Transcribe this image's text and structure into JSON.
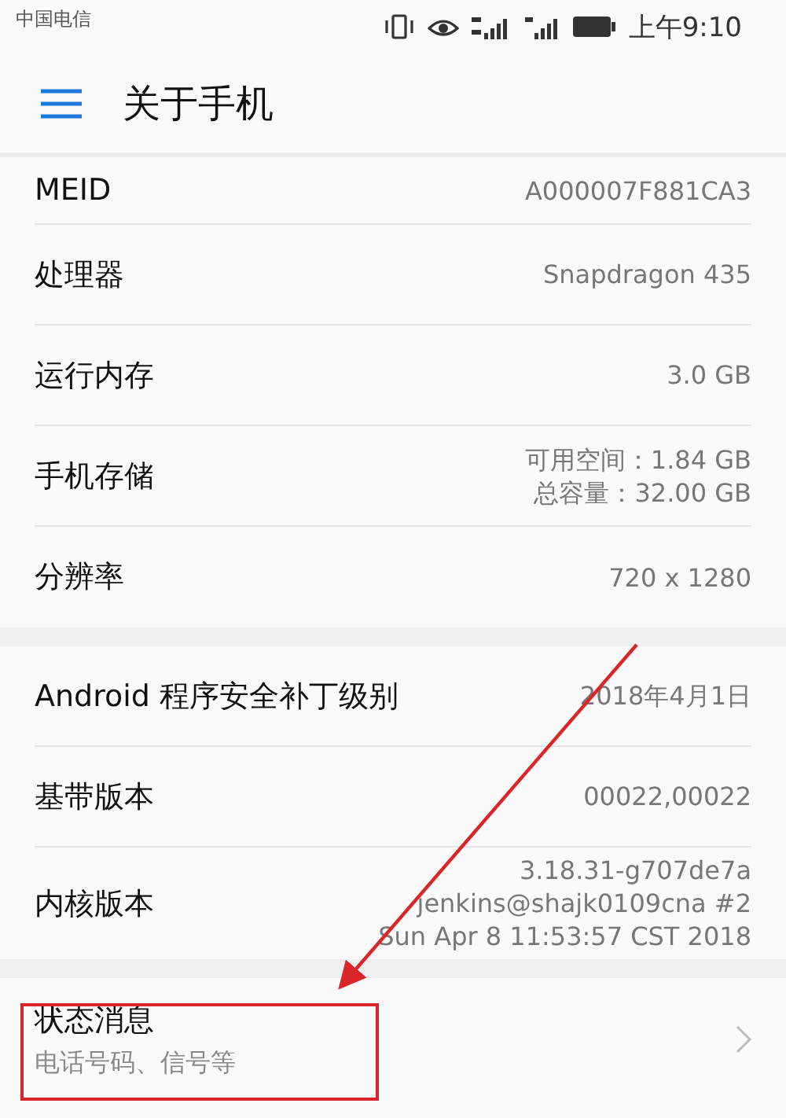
{
  "status_bar": {
    "carrier": "中国电信",
    "time": "上午9:10"
  },
  "app_bar": {
    "title": "关于手机"
  },
  "sections": [
    {
      "rows": [
        {
          "kind": "value",
          "label": "MEID",
          "values": [
            "A000007F881CA3"
          ]
        },
        {
          "kind": "value",
          "label": "处理器",
          "values": [
            "Snapdragon 435"
          ]
        },
        {
          "kind": "value",
          "label": "运行内存",
          "values": [
            "3.0 GB"
          ]
        },
        {
          "kind": "value",
          "label": "手机存储",
          "values": [
            "可用空间：1.84  GB",
            "总容量：32.00  GB"
          ]
        },
        {
          "kind": "value",
          "label": "分辨率",
          "values": [
            "720 x 1280"
          ]
        }
      ]
    },
    {
      "rows": [
        {
          "kind": "value",
          "label": "Android 程序安全补丁级别",
          "values": [
            "2018年4月1日"
          ]
        },
        {
          "kind": "value",
          "label": "基带版本",
          "values": [
            "00022,00022"
          ]
        },
        {
          "kind": "value",
          "label": "内核版本",
          "values": [
            "3.18.31-g707de7a",
            "jenkins@shajk0109cna #2",
            "Sun Apr 8 11:53:57 CST 2018"
          ]
        }
      ]
    },
    {
      "rows": [
        {
          "kind": "link",
          "label": "状态消息",
          "subtitle": "电话号码、信号等",
          "highlighted": true
        }
      ]
    }
  ]
}
